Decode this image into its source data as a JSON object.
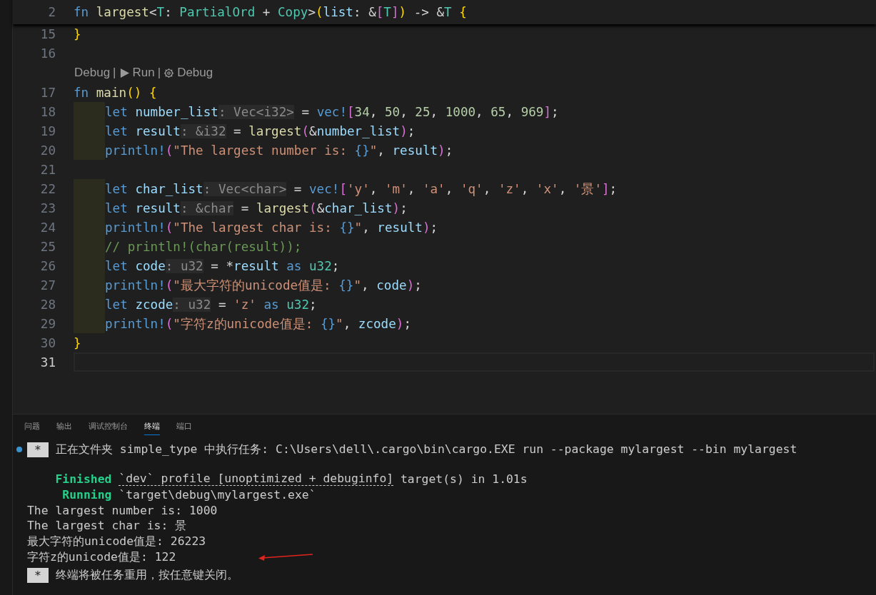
{
  "editor": {
    "sticky_line": {
      "number": "2",
      "tokens": [
        {
          "text": "fn ",
          "kind": "keyword"
        },
        {
          "text": "largest",
          "kind": "function"
        },
        {
          "text": "<",
          "kind": "punctuation"
        },
        {
          "text": "T",
          "kind": "type"
        },
        {
          "text": ": ",
          "kind": "punctuation"
        },
        {
          "text": "PartialOrd",
          "kind": "type"
        },
        {
          "text": " + ",
          "kind": "punctuation"
        },
        {
          "text": "Copy",
          "kind": "type"
        },
        {
          "text": ">",
          "kind": "punctuation"
        },
        {
          "text": "(",
          "kind": "bracket1"
        },
        {
          "text": "list",
          "kind": "variable"
        },
        {
          "text": ": &",
          "kind": "punctuation"
        },
        {
          "text": "[",
          "kind": "bracket2"
        },
        {
          "text": "T",
          "kind": "type"
        },
        {
          "text": "]",
          "kind": "bracket2"
        },
        {
          "text": ")",
          "kind": "bracket1"
        },
        {
          "text": " -> &",
          "kind": "punctuation"
        },
        {
          "text": "T",
          "kind": "type"
        },
        {
          "text": " {",
          "kind": "bracket1"
        }
      ]
    },
    "lines": [
      {
        "kind": "code",
        "number": "15",
        "indented": false,
        "current": false,
        "tokens": [
          {
            "text": "}",
            "kind": "bracket1"
          }
        ]
      },
      {
        "kind": "code",
        "number": "16",
        "indented": false,
        "current": false
      },
      {
        "kind": "codelens",
        "separator": "|",
        "items": [
          {
            "label": "Debug",
            "kind": "text"
          },
          {
            "label": "Run",
            "kind": "play"
          },
          {
            "label": "Debug",
            "kind": "gear"
          }
        ]
      },
      {
        "kind": "code",
        "number": "17",
        "indented": false,
        "current": false,
        "tokens": [
          {
            "text": "fn ",
            "kind": "keyword"
          },
          {
            "text": "main",
            "kind": "function"
          },
          {
            "text": "() {",
            "kind": "bracket1"
          }
        ]
      },
      {
        "kind": "code",
        "number": "18",
        "indented": true,
        "current": false,
        "tokens": [
          {
            "text": "let ",
            "kind": "keyword"
          },
          {
            "text": "number_list",
            "kind": "variable"
          },
          {
            "text": ": Vec<i32>",
            "kind": "hint"
          },
          {
            "text": " = ",
            "kind": "punctuation"
          },
          {
            "text": "vec!",
            "kind": "keyword"
          },
          {
            "text": "[",
            "kind": "bracket2"
          },
          {
            "text": "34",
            "kind": "number"
          },
          {
            "text": ", ",
            "kind": "punctuation"
          },
          {
            "text": "50",
            "kind": "number"
          },
          {
            "text": ", ",
            "kind": "punctuation"
          },
          {
            "text": "25",
            "kind": "number"
          },
          {
            "text": ", ",
            "kind": "punctuation"
          },
          {
            "text": "1000",
            "kind": "number"
          },
          {
            "text": ", ",
            "kind": "punctuation"
          },
          {
            "text": "65",
            "kind": "number"
          },
          {
            "text": ", ",
            "kind": "punctuation"
          },
          {
            "text": "969",
            "kind": "number"
          },
          {
            "text": "]",
            "kind": "bracket2"
          },
          {
            "text": ";",
            "kind": "punctuation"
          }
        ]
      },
      {
        "kind": "code",
        "number": "19",
        "indented": true,
        "current": false,
        "tokens": [
          {
            "text": "let ",
            "kind": "keyword"
          },
          {
            "text": "result",
            "kind": "variable"
          },
          {
            "text": ": &i32",
            "kind": "hint"
          },
          {
            "text": " = ",
            "kind": "punctuation"
          },
          {
            "text": "largest",
            "kind": "function"
          },
          {
            "text": "(",
            "kind": "bracket2"
          },
          {
            "text": "&",
            "kind": "punctuation"
          },
          {
            "text": "number_list",
            "kind": "variable"
          },
          {
            "text": ")",
            "kind": "bracket2"
          },
          {
            "text": ";",
            "kind": "punctuation"
          }
        ]
      },
      {
        "kind": "code",
        "number": "20",
        "indented": true,
        "current": false,
        "tokens": [
          {
            "text": "println!",
            "kind": "keyword"
          },
          {
            "text": "(",
            "kind": "bracket2"
          },
          {
            "text": "\"The largest number is: ",
            "kind": "string"
          },
          {
            "text": "{}",
            "kind": "escape"
          },
          {
            "text": "\"",
            "kind": "string"
          },
          {
            "text": ", ",
            "kind": "punctuation"
          },
          {
            "text": "result",
            "kind": "variable"
          },
          {
            "text": ")",
            "kind": "bracket2"
          },
          {
            "text": ";",
            "kind": "punctuation"
          }
        ]
      },
      {
        "kind": "code",
        "number": "21",
        "indented": false,
        "current": false
      },
      {
        "kind": "code",
        "number": "22",
        "indented": true,
        "current": false,
        "tokens": [
          {
            "text": "let ",
            "kind": "keyword"
          },
          {
            "text": "char_list",
            "kind": "variable"
          },
          {
            "text": ": Vec<char>",
            "kind": "hint"
          },
          {
            "text": " = ",
            "kind": "punctuation"
          },
          {
            "text": "vec!",
            "kind": "keyword"
          },
          {
            "text": "[",
            "kind": "bracket2"
          },
          {
            "text": "'y'",
            "kind": "string"
          },
          {
            "text": ", ",
            "kind": "punctuation"
          },
          {
            "text": "'m'",
            "kind": "string"
          },
          {
            "text": ", ",
            "kind": "punctuation"
          },
          {
            "text": "'a'",
            "kind": "string"
          },
          {
            "text": ", ",
            "kind": "punctuation"
          },
          {
            "text": "'q'",
            "kind": "string"
          },
          {
            "text": ", ",
            "kind": "punctuation"
          },
          {
            "text": "'z'",
            "kind": "string"
          },
          {
            "text": ", ",
            "kind": "punctuation"
          },
          {
            "text": "'x'",
            "kind": "string"
          },
          {
            "text": ", ",
            "kind": "punctuation"
          },
          {
            "text": "'景'",
            "kind": "string"
          },
          {
            "text": "]",
            "kind": "bracket2"
          },
          {
            "text": ";",
            "kind": "punctuation"
          }
        ]
      },
      {
        "kind": "code",
        "number": "23",
        "indented": true,
        "current": false,
        "tokens": [
          {
            "text": "let ",
            "kind": "keyword"
          },
          {
            "text": "result",
            "kind": "variable"
          },
          {
            "text": ": &char",
            "kind": "hint"
          },
          {
            "text": " = ",
            "kind": "punctuation"
          },
          {
            "text": "largest",
            "kind": "function"
          },
          {
            "text": "(",
            "kind": "bracket2"
          },
          {
            "text": "&",
            "kind": "punctuation"
          },
          {
            "text": "char_list",
            "kind": "variable"
          },
          {
            "text": ")",
            "kind": "bracket2"
          },
          {
            "text": ";",
            "kind": "punctuation"
          }
        ]
      },
      {
        "kind": "code",
        "number": "24",
        "indented": true,
        "current": false,
        "tokens": [
          {
            "text": "println!",
            "kind": "keyword"
          },
          {
            "text": "(",
            "kind": "bracket2"
          },
          {
            "text": "\"The largest char is: ",
            "kind": "string"
          },
          {
            "text": "{}",
            "kind": "escape"
          },
          {
            "text": "\"",
            "kind": "string"
          },
          {
            "text": ", ",
            "kind": "punctuation"
          },
          {
            "text": "result",
            "kind": "variable"
          },
          {
            "text": ")",
            "kind": "bracket2"
          },
          {
            "text": ";",
            "kind": "punctuation"
          }
        ]
      },
      {
        "kind": "code",
        "number": "25",
        "indented": true,
        "current": false,
        "tokens": [
          {
            "text": "// println!(char(result));",
            "kind": "comment"
          }
        ]
      },
      {
        "kind": "code",
        "number": "26",
        "indented": true,
        "current": false,
        "tokens": [
          {
            "text": "let ",
            "kind": "keyword"
          },
          {
            "text": "code",
            "kind": "variable"
          },
          {
            "text": ": u32",
            "kind": "hint"
          },
          {
            "text": " = *",
            "kind": "punctuation"
          },
          {
            "text": "result",
            "kind": "variable"
          },
          {
            "text": " as ",
            "kind": "keyword"
          },
          {
            "text": "u32",
            "kind": "type"
          },
          {
            "text": ";",
            "kind": "punctuation"
          }
        ]
      },
      {
        "kind": "code",
        "number": "27",
        "indented": true,
        "current": false,
        "tokens": [
          {
            "text": "println!",
            "kind": "keyword"
          },
          {
            "text": "(",
            "kind": "bracket2"
          },
          {
            "text": "\"最大字符的unicode值是: ",
            "kind": "string"
          },
          {
            "text": "{}",
            "kind": "escape"
          },
          {
            "text": "\"",
            "kind": "string"
          },
          {
            "text": ", ",
            "kind": "punctuation"
          },
          {
            "text": "code",
            "kind": "variable"
          },
          {
            "text": ")",
            "kind": "bracket2"
          },
          {
            "text": ";",
            "kind": "punctuation"
          }
        ]
      },
      {
        "kind": "code",
        "number": "28",
        "indented": true,
        "current": false,
        "tokens": [
          {
            "text": "let ",
            "kind": "keyword"
          },
          {
            "text": "zcode",
            "kind": "variable"
          },
          {
            "text": ": u32",
            "kind": "hint"
          },
          {
            "text": " = ",
            "kind": "punctuation"
          },
          {
            "text": "'z'",
            "kind": "string"
          },
          {
            "text": " as ",
            "kind": "keyword"
          },
          {
            "text": "u32",
            "kind": "type"
          },
          {
            "text": ";",
            "kind": "punctuation"
          }
        ]
      },
      {
        "kind": "code",
        "number": "29",
        "indented": true,
        "current": false,
        "tokens": [
          {
            "text": "println!",
            "kind": "keyword"
          },
          {
            "text": "(",
            "kind": "bracket2"
          },
          {
            "text": "\"字符z的unicode值是: ",
            "kind": "string"
          },
          {
            "text": "{}",
            "kind": "escape"
          },
          {
            "text": "\"",
            "kind": "string"
          },
          {
            "text": ", ",
            "kind": "punctuation"
          },
          {
            "text": "zcode",
            "kind": "variable"
          },
          {
            "text": ")",
            "kind": "bracket2"
          },
          {
            "text": ";",
            "kind": "punctuation"
          }
        ]
      },
      {
        "kind": "code",
        "number": "30",
        "indented": false,
        "current": false,
        "tokens": [
          {
            "text": "}",
            "kind": "bracket1"
          }
        ]
      },
      {
        "kind": "code",
        "number": "31",
        "indented": false,
        "current": true
      }
    ]
  },
  "panel": {
    "tabs": [
      {
        "label": "问题",
        "selected": false
      },
      {
        "label": "输出",
        "selected": false
      },
      {
        "label": "调试控制台",
        "selected": false
      },
      {
        "label": "终端",
        "selected": true
      },
      {
        "label": "端口",
        "selected": false
      }
    ],
    "terminal": [
      {
        "kind": "task",
        "dot": true,
        "badge": "*",
        "text": "正在文件夹 simple_type 中执行任务: C:\\Users\\dell\\.cargo\\bin\\cargo.EXE run --package mylargest --bin mylargest"
      },
      {
        "kind": "blank"
      },
      {
        "kind": "cargo",
        "status": "Finished",
        "underlined": "`dev` profile [unoptimized + debuginfo]",
        "rest": "target(s) in 1.01s"
      },
      {
        "kind": "cargo",
        "status": "Running",
        "rest": "`target\\debug\\mylargest.exe`"
      },
      {
        "kind": "plain",
        "text": "The largest number is: 1000"
      },
      {
        "kind": "plain",
        "text": "The largest char is: 景"
      },
      {
        "kind": "plain",
        "text": "最大字符的unicode值是: 26223"
      },
      {
        "kind": "plain",
        "text": "字符z的unicode值是: 122",
        "arrow": true
      },
      {
        "kind": "task",
        "dot": false,
        "badge": "*",
        "text": "终端将被任务重用，按任意键关闭。"
      }
    ]
  }
}
